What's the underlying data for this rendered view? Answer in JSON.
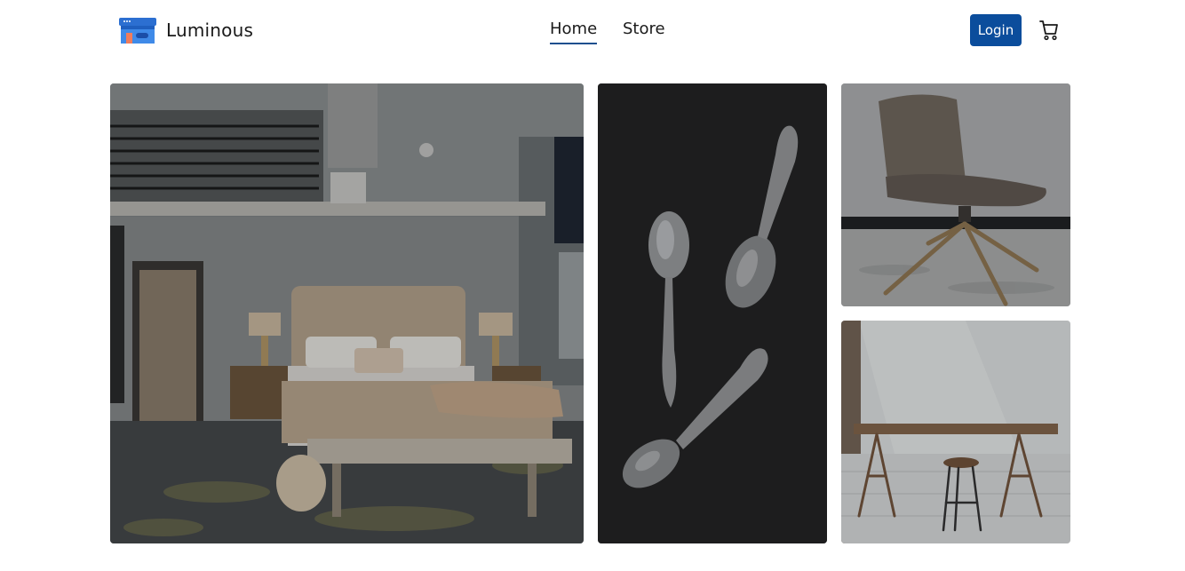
{
  "header": {
    "brand_name": "Luminous",
    "logo_icon": "store-icon",
    "nav": [
      {
        "label": "Home",
        "active": true
      },
      {
        "label": "Store",
        "active": false
      }
    ],
    "login_label": "Login",
    "cart_icon": "cart-icon"
  },
  "gallery": {
    "images": [
      {
        "subject": "bedroom"
      },
      {
        "subject": "spoons"
      },
      {
        "subject": "chair"
      },
      {
        "subject": "table-and-stool"
      }
    ]
  },
  "colors": {
    "accent": "#0b4d9c",
    "active_underline": "#1e4f8e",
    "text": "#1a1a1a",
    "background": "#ffffff"
  }
}
